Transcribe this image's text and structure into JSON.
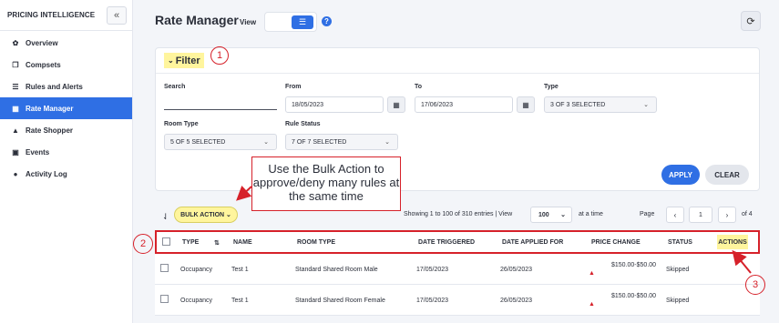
{
  "sidebar": {
    "title": "PRICING INTELLIGENCE",
    "collapse_icon": "«",
    "items": [
      {
        "label": "Overview",
        "icon": "dashboard-icon",
        "glyph": "✿"
      },
      {
        "label": "Compsets",
        "icon": "copy-icon",
        "glyph": "❐"
      },
      {
        "label": "Rules and Alerts",
        "icon": "list-icon",
        "glyph": "☰"
      },
      {
        "label": "Rate Manager",
        "icon": "calendar-icon",
        "glyph": "▦",
        "active": true
      },
      {
        "label": "Rate Shopper",
        "icon": "chart-icon",
        "glyph": "▲"
      },
      {
        "label": "Events",
        "icon": "calendar-check-icon",
        "glyph": "▣"
      },
      {
        "label": "Activity Log",
        "icon": "info-icon",
        "glyph": "●"
      }
    ]
  },
  "header": {
    "title": "Rate Manager",
    "view_label": "View",
    "view_icon": "☰",
    "help": "?",
    "refresh_icon": "⟳"
  },
  "filter": {
    "title": "Filter",
    "chevron": "⌄",
    "search_label": "Search",
    "search_value": "",
    "from_label": "From",
    "from_value": "18/05/2023",
    "to_label": "To",
    "to_value": "17/06/2023",
    "type_label": "Type",
    "type_value": "3 OF 3 SELECTED",
    "room_type_label": "Room Type",
    "room_type_value": "5 OF 5 SELECTED",
    "rule_status_label": "Rule Status",
    "rule_status_value": "7 OF 7 SELECTED",
    "calendar_glyph": "▦",
    "caret": "⌄",
    "apply": "APPLY",
    "clear": "CLEAR"
  },
  "annotations": {
    "callout_1": "1",
    "callout_2": "2",
    "callout_3": "3",
    "note": "Use the Bulk Action to approve/deny many rules at the same time"
  },
  "toolbar": {
    "sort_icon": "⇃",
    "bulk_action": "BULK ACTION ⌄",
    "entries": "Showing 1 to 100 of 310 entries | View",
    "per_page": "100",
    "at_a_time": "at a time",
    "page_label": "Page",
    "prev": "‹",
    "page_value": "1",
    "next": "›",
    "of_pages": "of 4"
  },
  "table": {
    "columns": [
      "TYPE",
      "NAME",
      "ROOM TYPE",
      "DATE TRIGGERED",
      "DATE APPLIED FOR",
      "PRICE CHANGE",
      "STATUS",
      "ACTIONS"
    ],
    "sort_glyph": "⇅",
    "rows": [
      {
        "type": "Occupancy",
        "name": "Test 1",
        "room_type": "Standard Shared Room Male",
        "date_triggered": "17/05/2023",
        "date_applied": "26/05/2023",
        "price_change": "$150.00-$50.00",
        "status": "Skipped",
        "warn": "▲"
      },
      {
        "type": "Occupancy",
        "name": "Test 1",
        "room_type": "Standard Shared Room Female",
        "date_triggered": "17/05/2023",
        "date_applied": "26/05/2023",
        "price_change": "$150.00-$50.00",
        "status": "Skipped",
        "warn": "▲"
      }
    ]
  },
  "colors": {
    "accent": "#2f6fe4",
    "highlight": "#fff59d",
    "annotation_red": "#d6212a"
  }
}
